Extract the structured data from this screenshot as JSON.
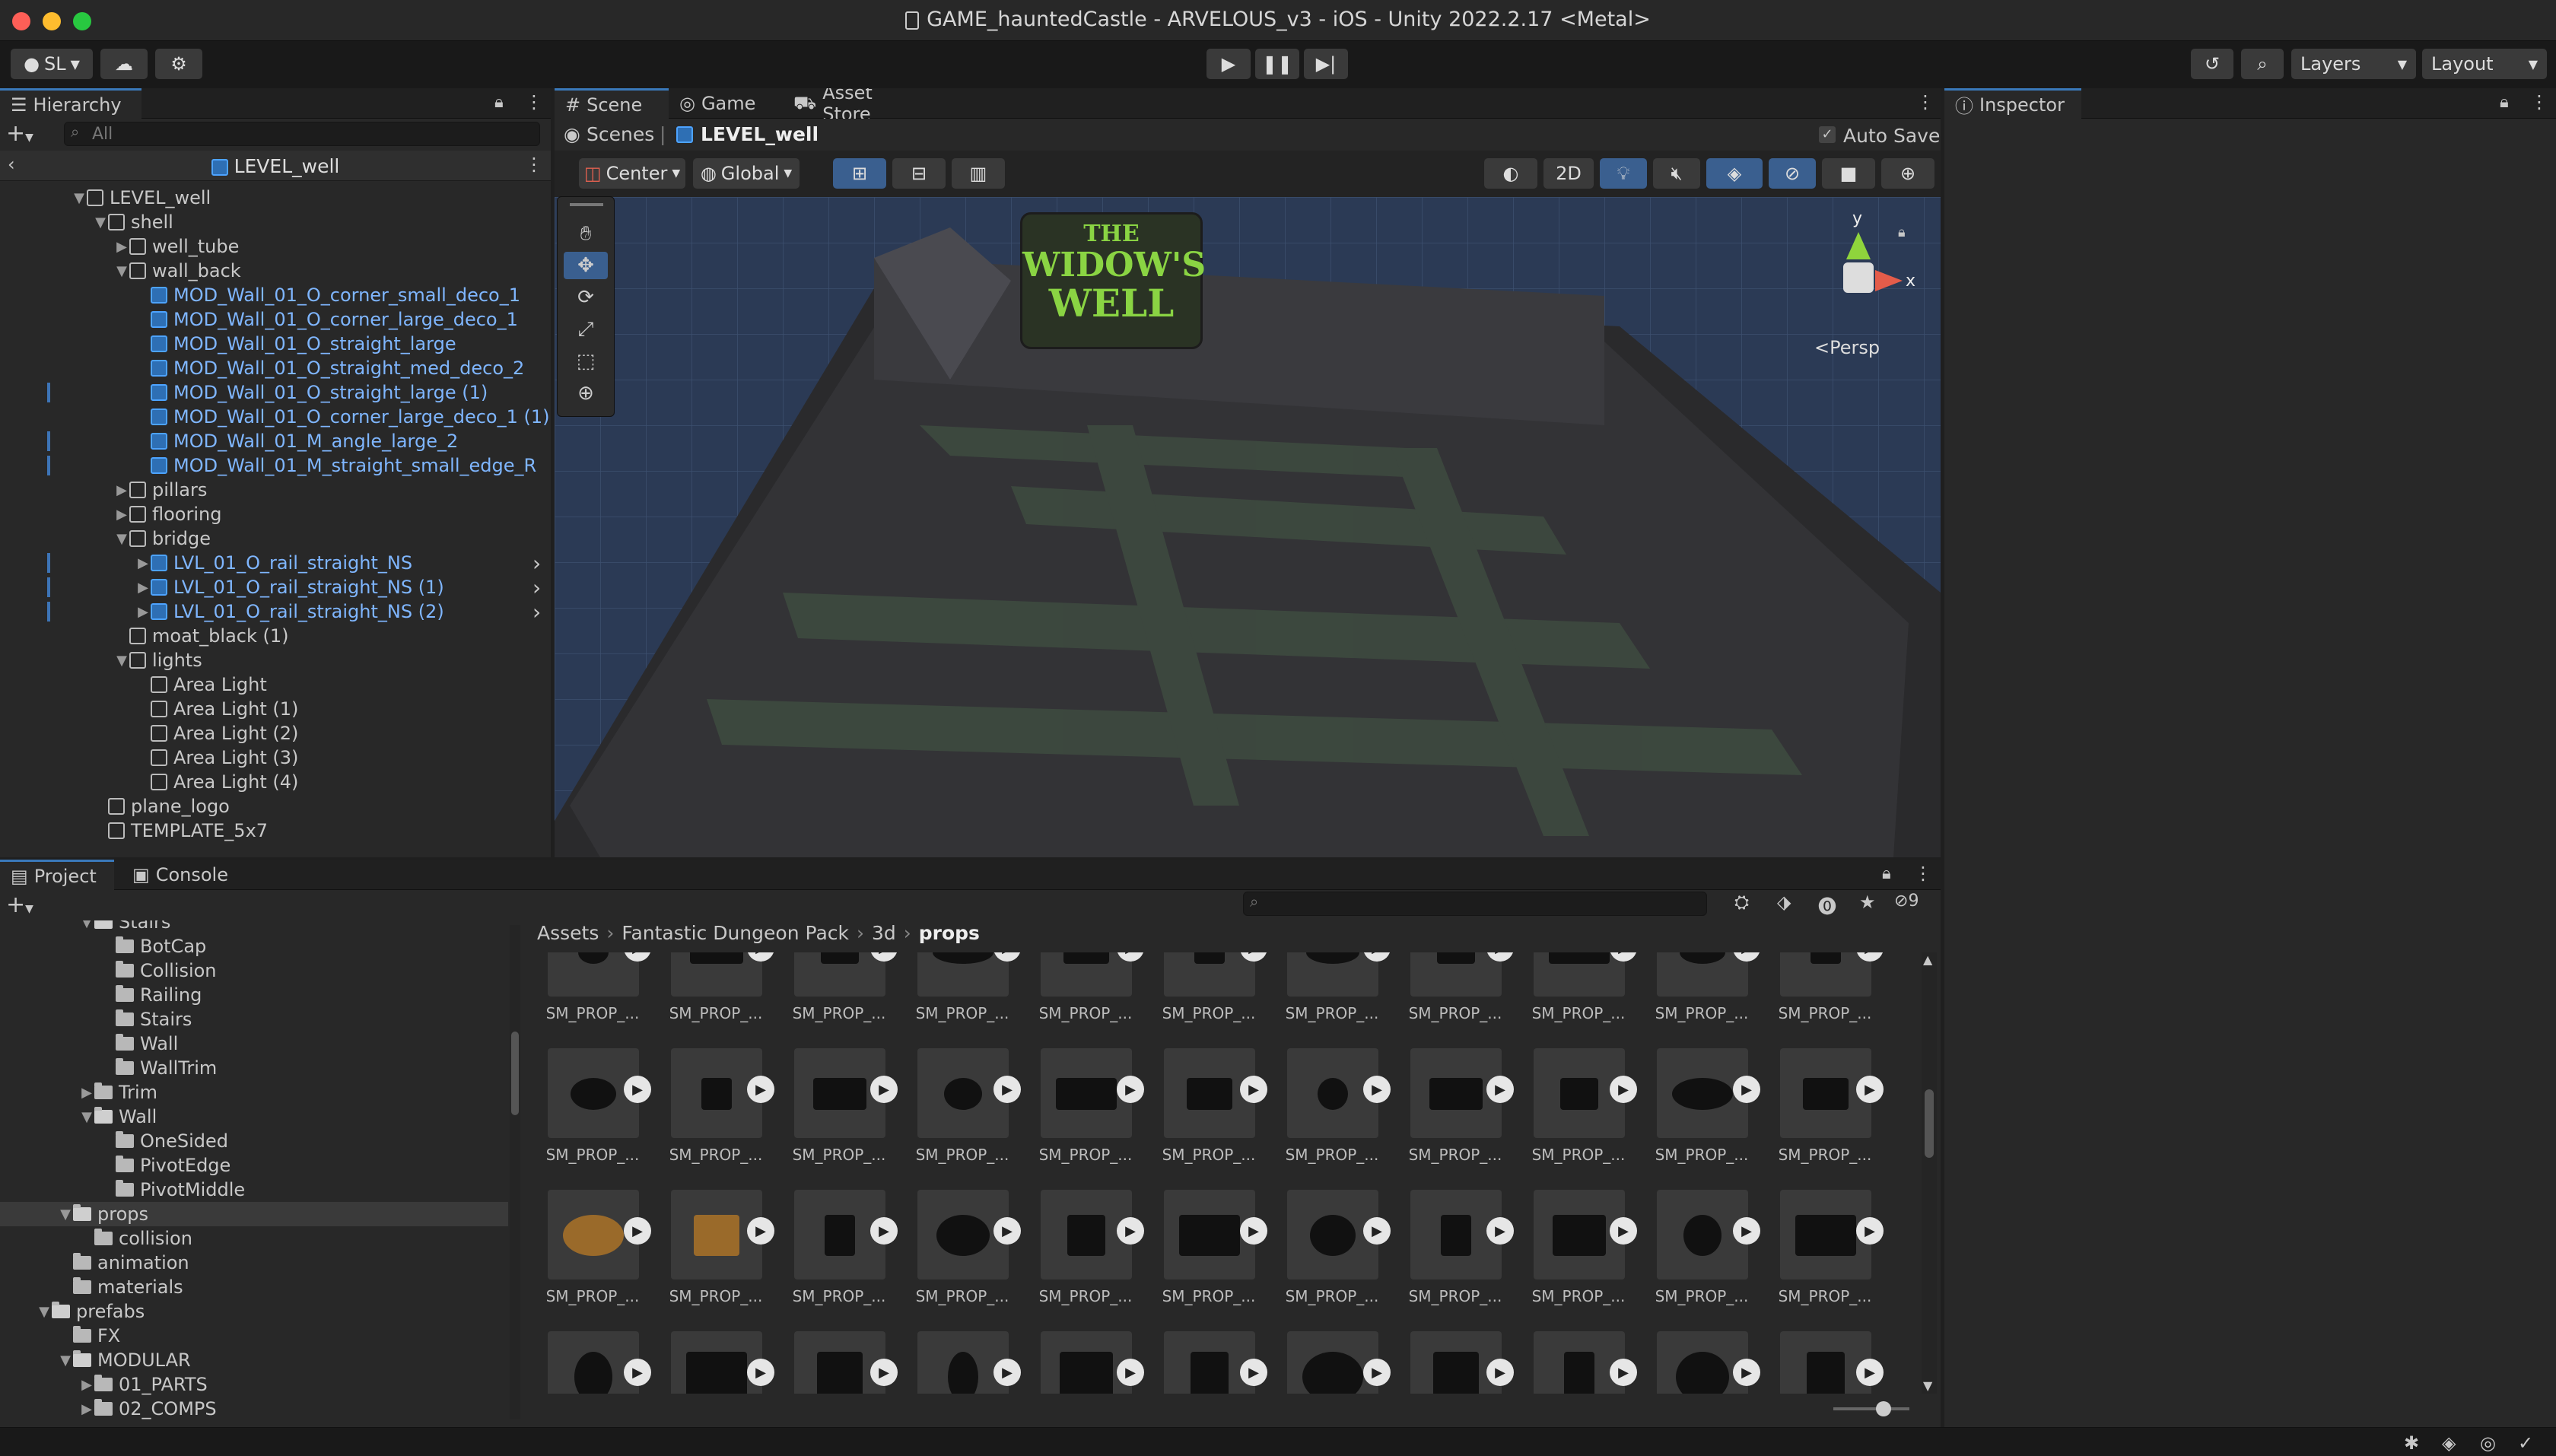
{
  "window": {
    "title": "GAME_hauntedCastle - ARVELOUS_v3 - iOS - Unity 2022.2.17 <Metal>",
    "traffic_colors": [
      "#fe5f57",
      "#febc2e",
      "#28c840"
    ]
  },
  "toolbar": {
    "account_label": "SL",
    "layers_label": "Layers",
    "layout_label": "Layout"
  },
  "hierarchy": {
    "tab_label": "Hierarchy",
    "search_placeholder": "All",
    "scene_name": "LEVEL_well",
    "rows": [
      {
        "label": "LEVEL_well",
        "depth": 0,
        "arrow": "▼",
        "prefab": false,
        "mark": false,
        "chev": false
      },
      {
        "label": "shell",
        "depth": 1,
        "arrow": "▼",
        "prefab": false,
        "mark": false,
        "chev": false
      },
      {
        "label": "well_tube",
        "depth": 2,
        "arrow": "▶",
        "prefab": false,
        "mark": false,
        "chev": false
      },
      {
        "label": "wall_back",
        "depth": 2,
        "arrow": "▼",
        "prefab": false,
        "mark": false,
        "chev": false
      },
      {
        "label": "MOD_Wall_01_O_corner_small_deco_1",
        "depth": 3,
        "arrow": "",
        "prefab": true,
        "mark": false,
        "chev": false
      },
      {
        "label": "MOD_Wall_01_O_corner_large_deco_1",
        "depth": 3,
        "arrow": "",
        "prefab": true,
        "mark": false,
        "chev": false
      },
      {
        "label": "MOD_Wall_01_O_straight_large",
        "depth": 3,
        "arrow": "",
        "prefab": true,
        "mark": false,
        "chev": false
      },
      {
        "label": "MOD_Wall_01_O_straight_med_deco_2",
        "depth": 3,
        "arrow": "",
        "prefab": true,
        "mark": false,
        "chev": false
      },
      {
        "label": "MOD_Wall_01_O_straight_large (1)",
        "depth": 3,
        "arrow": "",
        "prefab": true,
        "mark": true,
        "chev": false
      },
      {
        "label": "MOD_Wall_01_O_corner_large_deco_1 (1)",
        "depth": 3,
        "arrow": "",
        "prefab": true,
        "mark": false,
        "chev": false
      },
      {
        "label": "MOD_Wall_01_M_angle_large_2",
        "depth": 3,
        "arrow": "",
        "prefab": true,
        "mark": true,
        "chev": false
      },
      {
        "label": "MOD_Wall_01_M_straight_small_edge_R",
        "depth": 3,
        "arrow": "",
        "prefab": true,
        "mark": true,
        "chev": false
      },
      {
        "label": "pillars",
        "depth": 2,
        "arrow": "▶",
        "prefab": false,
        "mark": false,
        "chev": false
      },
      {
        "label": "flooring",
        "depth": 2,
        "arrow": "▶",
        "prefab": false,
        "mark": false,
        "chev": false
      },
      {
        "label": "bridge",
        "depth": 2,
        "arrow": "▼",
        "prefab": false,
        "mark": false,
        "chev": false
      },
      {
        "label": "LVL_01_O_rail_straight_NS",
        "depth": 3,
        "arrow": "▶",
        "prefab": true,
        "mark": true,
        "chev": true
      },
      {
        "label": "LVL_01_O_rail_straight_NS (1)",
        "depth": 3,
        "arrow": "▶",
        "prefab": true,
        "mark": true,
        "chev": true
      },
      {
        "label": "LVL_01_O_rail_straight_NS (2)",
        "depth": 3,
        "arrow": "▶",
        "prefab": true,
        "mark": true,
        "chev": true
      },
      {
        "label": "moat_black (1)",
        "depth": 2,
        "arrow": "",
        "prefab": false,
        "mark": false,
        "chev": false
      },
      {
        "label": "lights",
        "depth": 2,
        "arrow": "▼",
        "prefab": false,
        "mark": false,
        "chev": false
      },
      {
        "label": "Area Light",
        "depth": 3,
        "arrow": "",
        "prefab": false,
        "mark": false,
        "chev": false
      },
      {
        "label": "Area Light (1)",
        "depth": 3,
        "arrow": "",
        "prefab": false,
        "mark": false,
        "chev": false
      },
      {
        "label": "Area Light (2)",
        "depth": 3,
        "arrow": "",
        "prefab": false,
        "mark": false,
        "chev": false
      },
      {
        "label": "Area Light (3)",
        "depth": 3,
        "arrow": "",
        "prefab": false,
        "mark": false,
        "chev": false
      },
      {
        "label": "Area Light (4)",
        "depth": 3,
        "arrow": "",
        "prefab": false,
        "mark": false,
        "chev": false
      },
      {
        "label": "plane_logo",
        "depth": 1,
        "arrow": "",
        "prefab": false,
        "mark": false,
        "chev": false
      },
      {
        "label": "TEMPLATE_5x7",
        "depth": 1,
        "arrow": "",
        "prefab": false,
        "mark": false,
        "chev": false
      }
    ]
  },
  "scene": {
    "tabs": [
      "Scene",
      "Game",
      "Asset Store"
    ],
    "breadcrumb_root": "Scenes",
    "breadcrumb_scene": "LEVEL_well",
    "auto_save_label": "Auto Save",
    "pivot_label": "Center",
    "space_label": "Global",
    "mode_2d": "2D",
    "persp_label": "Persp",
    "axis_y": "y",
    "axis_x": "x",
    "logo_line1": "THE",
    "logo_line2": "WIDOW'S",
    "logo_line3": "WELL"
  },
  "inspector": {
    "tab_label": "Inspector"
  },
  "project": {
    "tabs": [
      "Project",
      "Console"
    ],
    "filter_count": "9",
    "breadcrumb": [
      "Assets",
      "Fantastic Dungeon Pack",
      "3d",
      "props"
    ],
    "tree": [
      {
        "label": "Stairs",
        "depth": 3,
        "arrow": "▼",
        "open": true
      },
      {
        "label": "BotCap",
        "depth": 4,
        "arrow": "",
        "open": false
      },
      {
        "label": "Collision",
        "depth": 4,
        "arrow": "",
        "open": false
      },
      {
        "label": "Railing",
        "depth": 4,
        "arrow": "",
        "open": false
      },
      {
        "label": "Stairs",
        "depth": 4,
        "arrow": "",
        "open": false
      },
      {
        "label": "Wall",
        "depth": 4,
        "arrow": "",
        "open": false
      },
      {
        "label": "WallTrim",
        "depth": 4,
        "arrow": "",
        "open": false
      },
      {
        "label": "Trim",
        "depth": 3,
        "arrow": "▶",
        "open": false
      },
      {
        "label": "Wall",
        "depth": 3,
        "arrow": "▼",
        "open": true
      },
      {
        "label": "OneSided",
        "depth": 4,
        "arrow": "",
        "open": false
      },
      {
        "label": "PivotEdge",
        "depth": 4,
        "arrow": "",
        "open": false
      },
      {
        "label": "PivotMiddle",
        "depth": 4,
        "arrow": "",
        "open": false
      },
      {
        "label": "props",
        "depth": 2,
        "arrow": "▼",
        "open": true
      },
      {
        "label": "collision",
        "depth": 3,
        "arrow": "",
        "open": false
      },
      {
        "label": "animation",
        "depth": 2,
        "arrow": "",
        "open": false
      },
      {
        "label": "materials",
        "depth": 2,
        "arrow": "",
        "open": false
      },
      {
        "label": "prefabs",
        "depth": 1,
        "arrow": "▼",
        "open": true
      },
      {
        "label": "FX",
        "depth": 2,
        "arrow": "",
        "open": false
      },
      {
        "label": "MODULAR",
        "depth": 2,
        "arrow": "▼",
        "open": true
      },
      {
        "label": "01_PARTS",
        "depth": 3,
        "arrow": "▶",
        "open": false
      },
      {
        "label": "02_COMPS",
        "depth": 3,
        "arrow": "▶",
        "open": false
      }
    ],
    "asset_label": "SM_PROP_...",
    "selected_tree_label": "props"
  }
}
